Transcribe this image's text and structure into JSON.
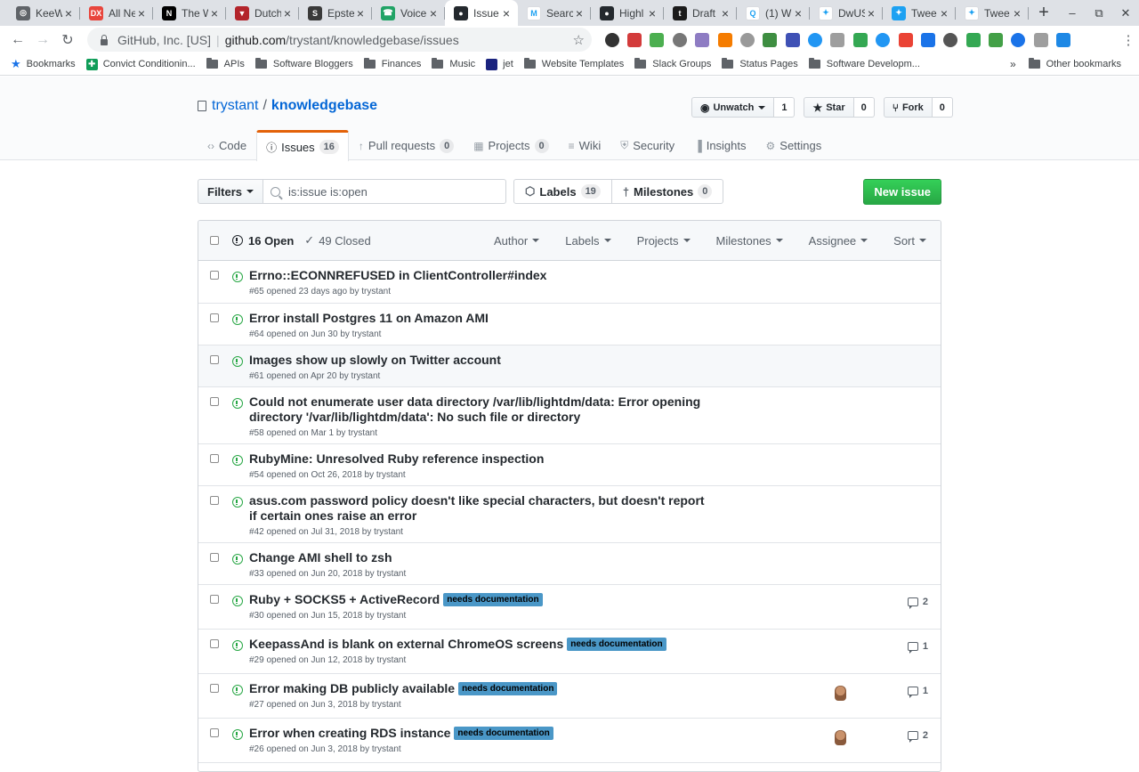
{
  "browser": {
    "tabs": [
      {
        "title": "KeeW",
        "color": "#5f6368",
        "glyph": "◎",
        "active": false
      },
      {
        "title": "All Ne",
        "color": "#e8453c",
        "glyph": "DX",
        "active": false
      },
      {
        "title": "The W",
        "color": "#000000",
        "glyph": "N",
        "active": false
      },
      {
        "title": "Dutch",
        "color": "#b3242b",
        "glyph": "▼",
        "active": false
      },
      {
        "title": "Epste",
        "color": "#3a3a3a",
        "glyph": "S",
        "active": false
      },
      {
        "title": "Voice",
        "color": "#21a366",
        "glyph": "☎",
        "active": false
      },
      {
        "title": "Issue",
        "color": "#24292e",
        "glyph": "●",
        "active": true
      },
      {
        "title": "Searc",
        "color": "#ffffff",
        "glyph": "M",
        "active": false
      },
      {
        "title": "Highl",
        "color": "#24292e",
        "glyph": "●",
        "active": false
      },
      {
        "title": "Draft",
        "color": "#1b1b1b",
        "glyph": "t",
        "active": false
      },
      {
        "title": "(1) W",
        "color": "#ffffff",
        "glyph": "Q",
        "active": false
      },
      {
        "title": "DwUS",
        "color": "#ffffff",
        "glyph": "✦",
        "active": false
      },
      {
        "title": "Twee",
        "color": "#1da1f2",
        "glyph": "✦",
        "active": false
      },
      {
        "title": "Twee",
        "color": "#ffffff",
        "glyph": "✦",
        "active": false
      }
    ],
    "close_glyph": "×",
    "new_tab_glyph": "+",
    "window_controls": [
      "–",
      "⧉",
      "✕"
    ],
    "nav": {
      "back": "←",
      "forward": "→",
      "reload": "↻"
    },
    "address": {
      "org": "GitHub, Inc. [US]",
      "separator": "|",
      "host": "github.com",
      "path": "/trystant/knowledgebase/issues",
      "star_glyph": "☆"
    },
    "extension_colors": [
      "#333333",
      "#d33b3b",
      "#4caf50",
      "#777777",
      "#8e7cc3",
      "#f57c00",
      "#999999",
      "#3e8e41",
      "#3f51b5",
      "#2196f3",
      "#9e9e9e",
      "#34a853",
      "#2196f3",
      "#ea4335",
      "#1a73e8",
      "#555555",
      "#34a853",
      "#43a047",
      "#1a73e8",
      "#9e9e9e",
      "#1e88e5"
    ],
    "menu_glyph": "⋮",
    "bookmarks": [
      {
        "label": "Bookmarks",
        "kind": "star"
      },
      {
        "label": "Convict Conditionin...",
        "kind": "plus"
      },
      {
        "label": "APIs",
        "kind": "folder"
      },
      {
        "label": "Software Bloggers",
        "kind": "folder"
      },
      {
        "label": "Finances",
        "kind": "folder"
      },
      {
        "label": "Music",
        "kind": "folder"
      },
      {
        "label": "jet",
        "kind": "app"
      },
      {
        "label": "Website Templates",
        "kind": "folder"
      },
      {
        "label": "Slack Groups",
        "kind": "folder"
      },
      {
        "label": "Status Pages",
        "kind": "folder"
      },
      {
        "label": "Software Developm...",
        "kind": "folder"
      }
    ],
    "bookmarks_overflow": "»",
    "other_bookmarks": "Other bookmarks"
  },
  "repo": {
    "owner": "trystant",
    "slash": "/",
    "name": "knowledgebase",
    "watch": {
      "label": "Unwatch",
      "count": "1",
      "icon": "◉"
    },
    "star": {
      "label": "Star",
      "count": "0",
      "icon": "★"
    },
    "fork": {
      "label": "Fork",
      "count": "0",
      "icon": "⑂"
    },
    "tabs": [
      {
        "label": "Code",
        "icon": "‹›",
        "counter": "",
        "selected": false
      },
      {
        "label": "Issues",
        "icon": "ⓘ",
        "counter": "16",
        "selected": true
      },
      {
        "label": "Pull requests",
        "icon": "↑",
        "counter": "0",
        "selected": false
      },
      {
        "label": "Projects",
        "icon": "▦",
        "counter": "0",
        "selected": false
      },
      {
        "label": "Wiki",
        "icon": "≡",
        "counter": "",
        "selected": false
      },
      {
        "label": "Security",
        "icon": "⛨",
        "counter": "",
        "selected": false
      },
      {
        "label": "Insights",
        "icon": "▐",
        "counter": "",
        "selected": false
      },
      {
        "label": "Settings",
        "icon": "⚙",
        "counter": "",
        "selected": false
      }
    ]
  },
  "subnav": {
    "filters_label": "Filters",
    "search_value": "is:issue is:open",
    "labels": {
      "label": "Labels",
      "count": "19",
      "icon": "⬡"
    },
    "milestones": {
      "label": "Milestones",
      "count": "0",
      "icon": "†"
    },
    "new_issue": "New issue"
  },
  "issues_header": {
    "open_label": "16 Open",
    "closed_label": "49 Closed",
    "check_glyph": "✓",
    "sorters": [
      "Author",
      "Labels",
      "Projects",
      "Milestones",
      "Assignee",
      "Sort"
    ]
  },
  "colors": {
    "open_green": "#28a745",
    "label_blue": "#4a97c7",
    "link_blue": "#0366d6",
    "active_tab_orange": "#e36209"
  },
  "issues": [
    {
      "title": "Errno::ECONNREFUSED in ClientController#index",
      "meta": "#65 opened 23 days ago by trystant",
      "label": "",
      "comments": "",
      "avatar": false,
      "highlight": false,
      "height": 48
    },
    {
      "title": "Error install Postgres 11 on Amazon AMI",
      "meta": "#64 opened on Jun 30 by trystant",
      "label": "",
      "comments": "",
      "avatar": false,
      "highlight": false,
      "height": 47
    },
    {
      "title": "Images show up slowly on Twitter account",
      "meta": "#61 opened on Apr 20 by trystant",
      "label": "",
      "comments": "",
      "avatar": false,
      "highlight": true,
      "height": 47
    },
    {
      "title": "Could not enumerate user data directory /var/lib/lightdm/data: Error opening directory '/var/lib/lightdm/data': No such file or directory",
      "meta": "#58 opened on Mar 1 by trystant",
      "label": "",
      "comments": "",
      "avatar": false,
      "highlight": false,
      "height": 64
    },
    {
      "title": "RubyMine: Unresolved Ruby reference inspection",
      "meta": "#54 opened on Oct 26, 2018 by trystant",
      "label": "",
      "comments": "",
      "avatar": false,
      "highlight": false,
      "height": 47
    },
    {
      "title": "asus.com password policy doesn't like special characters, but doesn't report if certain ones raise an error",
      "meta": "#42 opened on Jul 31, 2018 by trystant",
      "label": "",
      "comments": "",
      "avatar": false,
      "highlight": false,
      "height": 64
    },
    {
      "title": "Change AMI shell to zsh",
      "meta": "#33 opened on Jun 20, 2018 by trystant",
      "label": "",
      "comments": "",
      "avatar": false,
      "highlight": false,
      "height": 47
    },
    {
      "title": "Ruby + SOCKS5 + ActiveRecord",
      "meta": "#30 opened on Jun 15, 2018 by trystant",
      "label": "needs documentation",
      "comments": "2",
      "avatar": false,
      "highlight": false,
      "height": 50
    },
    {
      "title": "KeepassAnd is blank on external ChromeOS screens",
      "meta": "#29 opened on Jun 12, 2018 by trystant",
      "label": "needs documentation",
      "comments": "1",
      "avatar": false,
      "highlight": false,
      "height": 50
    },
    {
      "title": "Error making DB publicly available",
      "meta": "#27 opened on Jun 3, 2018 by trystant",
      "label": "needs documentation",
      "comments": "1",
      "avatar": true,
      "highlight": false,
      "height": 50
    },
    {
      "title": "Error when creating RDS instance",
      "meta": "#26 opened on Jun 3, 2018 by trystant",
      "label": "needs documentation",
      "comments": "2",
      "avatar": true,
      "highlight": false,
      "height": 50
    }
  ]
}
